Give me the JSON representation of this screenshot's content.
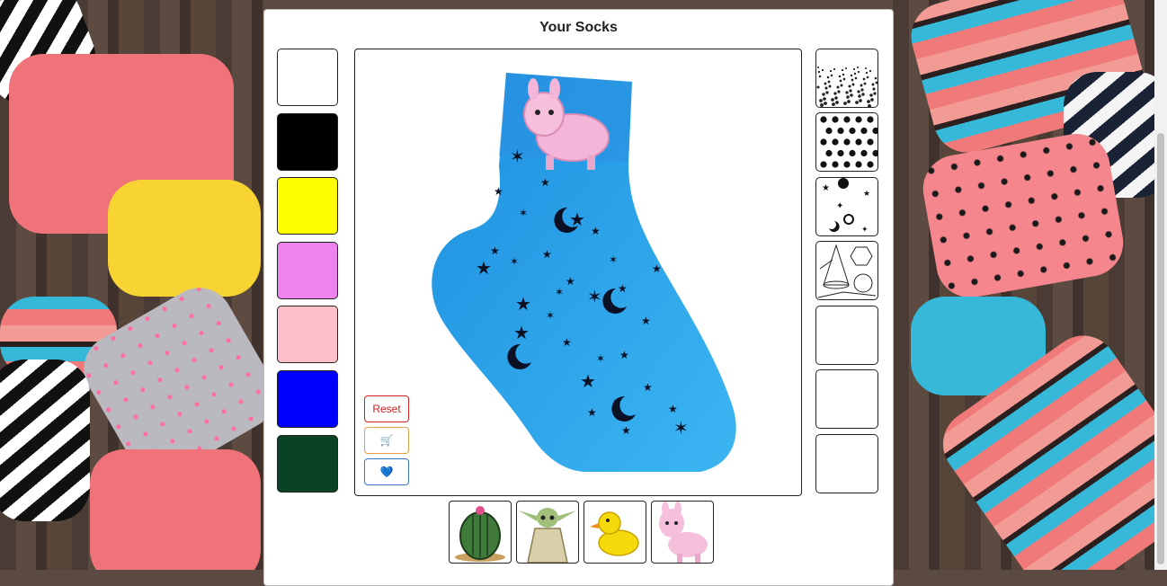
{
  "app": {
    "title": "Your Socks"
  },
  "colors": {
    "items": [
      {
        "name": "white",
        "hex": "#ffffff"
      },
      {
        "name": "black",
        "hex": "#000000"
      },
      {
        "name": "yellow",
        "hex": "#ffff00"
      },
      {
        "name": "violet",
        "hex": "#ee82ee"
      },
      {
        "name": "pink",
        "hex": "#ffc0cb"
      },
      {
        "name": "blue",
        "hex": "#0000ff"
      },
      {
        "name": "dark-green",
        "hex": "#0a4225"
      }
    ]
  },
  "patterns": {
    "items": [
      "scatter-dots",
      "polka-dots",
      "space",
      "geometric",
      "empty",
      "empty",
      "empty"
    ]
  },
  "actions": {
    "reset_label": "Reset",
    "cart_icon": "🛒",
    "favorite_icon": "💙",
    "reset_color": "#d21f1f",
    "cart_color": "#e0a050",
    "favorite_color": "#3a72c8"
  },
  "preview": {
    "sock_color": "#2aa3e8",
    "pattern": "space",
    "sticker": "llama"
  },
  "stickers": {
    "items": [
      "cactus",
      "baby-yoda",
      "rubber-duck",
      "llama"
    ]
  }
}
